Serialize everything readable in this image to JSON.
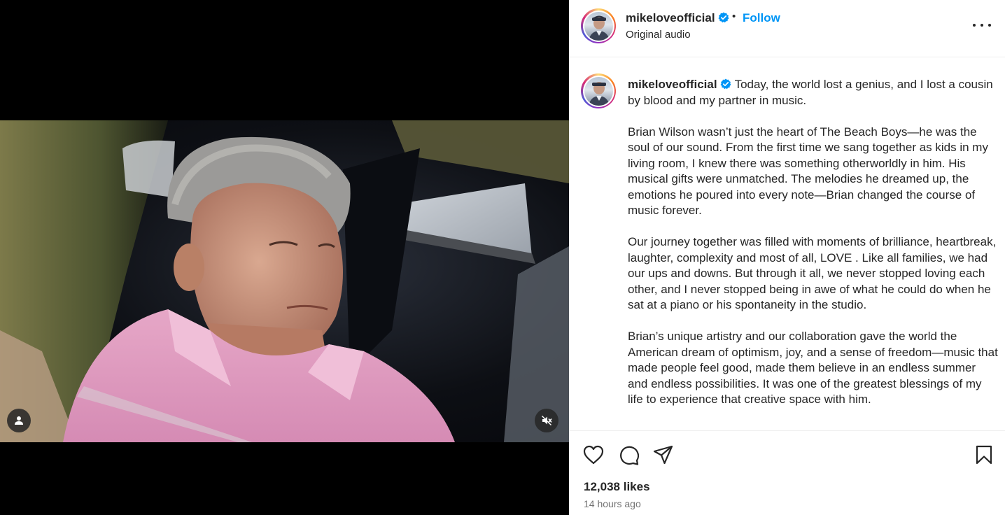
{
  "post": {
    "username": "mikeloveofficial",
    "verified": true,
    "follow_label": "Follow",
    "separator": "•",
    "audio_label": "Original audio",
    "caption_lead": "Today, the world lost a genius, and I lost a cousin by blood and my partner in music.",
    "caption_paragraphs": [
      "Brian Wilson wasn’t just the heart of The Beach Boys—he was the soul of our sound. From the first time we sang together as kids in my living room, I knew there was something otherworldly in him. His musical gifts were unmatched. The melodies he dreamed up, the emotions he poured into every note—Brian changed the course of music forever.",
      "Our journey together was filled with moments of brilliance, heartbreak, laughter, complexity and most of all, LOVE . Like all families, we had our ups and downs. But through it all, we never stopped loving each other, and I never stopped being in awe of what he could do when he sat at a piano or his spontaneity in the studio.",
      "Brian’s unique artistry and our collaboration gave the world the American dream of optimism, joy, and a sense of freedom—music that made people feel good, made them believe in an endless summer and endless possibilities. It was one of the greatest blessings of my life to experience that creative space with him."
    ],
    "likes": "12,038 likes",
    "timestamp": "14 hours ago"
  },
  "media": {
    "tag_icon": "user-tag-icon",
    "mute_icon": "speaker-muted-icon"
  },
  "actions": {
    "like_icon": "heart-icon",
    "comment_icon": "comment-bubble-icon",
    "share_icon": "paper-plane-icon",
    "save_icon": "bookmark-icon",
    "more_icon": "more-options-icon"
  },
  "colors": {
    "follow": "#0095f6",
    "verified": "#0095f6",
    "text": "#262626",
    "muted": "#737373"
  }
}
